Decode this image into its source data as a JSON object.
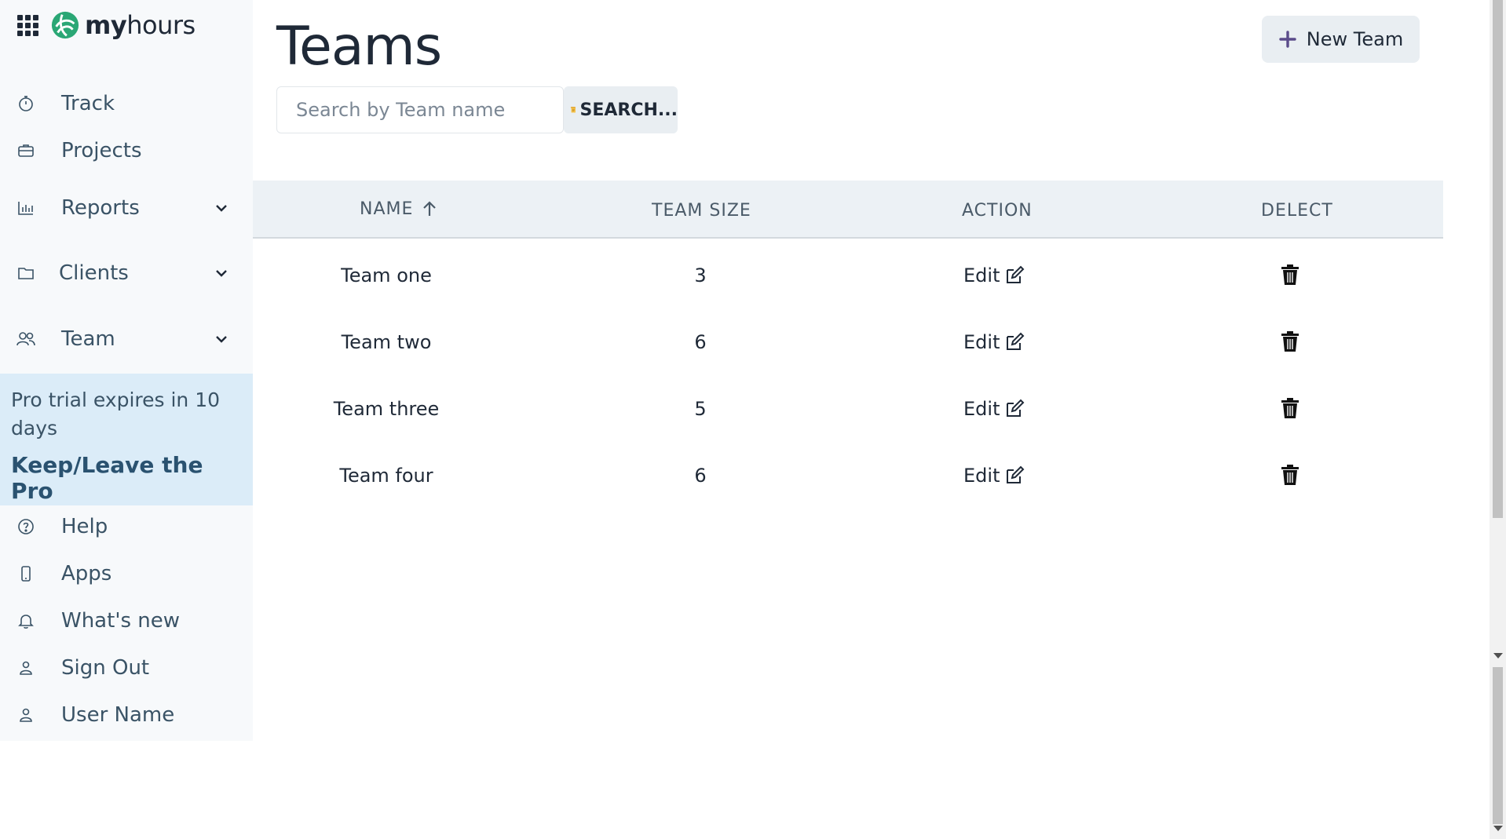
{
  "brand": {
    "name_bold": "my",
    "name_rest": "hours"
  },
  "sidebar": {
    "items": [
      {
        "label": "Track",
        "icon": "stopwatch-icon"
      },
      {
        "label": "Projects",
        "icon": "briefcase-icon"
      },
      {
        "label": "Reports",
        "icon": "bar-chart-icon",
        "expandable": true
      },
      {
        "label": "Clients",
        "icon": "folder-icon",
        "expandable": true
      },
      {
        "label": "Team",
        "icon": "users-icon",
        "expandable": true
      }
    ],
    "promo": {
      "text": "Pro trial expires in 10 days",
      "link": "Keep/Leave the Pro"
    },
    "bottom_items": [
      {
        "label": "Help",
        "icon": "help-circle-icon"
      },
      {
        "label": "Apps",
        "icon": "phone-icon"
      },
      {
        "label": "What's new",
        "icon": "bell-icon"
      },
      {
        "label": "Sign Out",
        "icon": "user-icon"
      },
      {
        "label": "User Name",
        "icon": "user-icon"
      }
    ]
  },
  "page": {
    "title": "Teams",
    "new_button": "New Team",
    "search": {
      "placeholder": "Search by Team name",
      "button": "SEARCH..."
    }
  },
  "table": {
    "columns": [
      "NAME",
      "TEAM SIZE",
      "ACTION",
      "DELECT"
    ],
    "sort": {
      "column": "NAME",
      "direction": "ascending"
    },
    "rows": [
      {
        "name": "Team one",
        "size": "3",
        "action": "Edit"
      },
      {
        "name": "Team two",
        "size": "6",
        "action": "Edit"
      },
      {
        "name": "Team three",
        "size": "5",
        "action": "Edit"
      },
      {
        "name": "Team four",
        "size": "6",
        "action": "Edit"
      }
    ]
  },
  "colors": {
    "accent": "#2aa775",
    "sidebar_bg": "#f7f9fb",
    "promo_bg": "#dbecf8",
    "header_bg": "#ecf1f5"
  }
}
